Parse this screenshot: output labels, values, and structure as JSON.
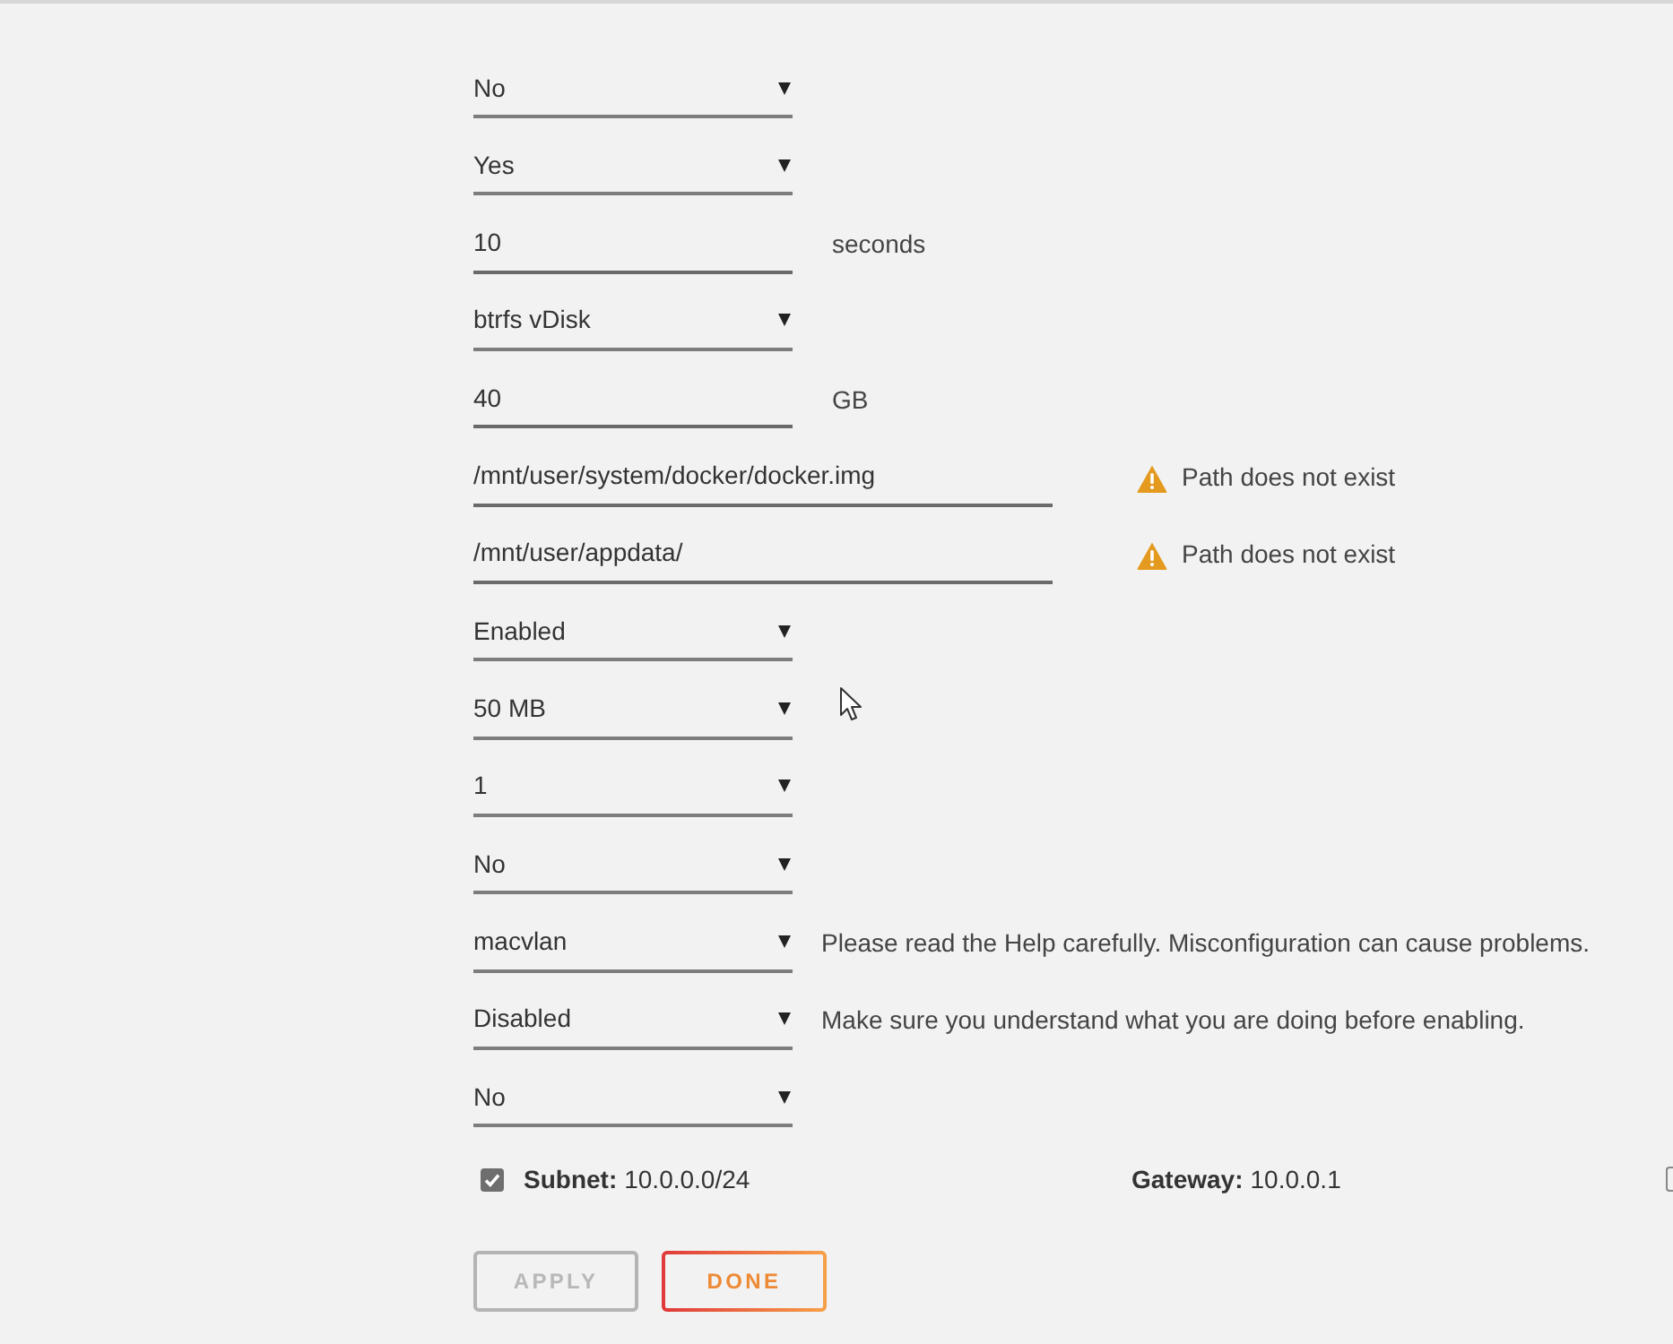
{
  "fields": [
    {
      "kind": "select",
      "value": "No"
    },
    {
      "kind": "select",
      "value": "Yes"
    },
    {
      "kind": "number",
      "value": "10",
      "unit": "seconds"
    },
    {
      "kind": "select",
      "value": "btrfs vDisk"
    },
    {
      "kind": "number",
      "value": "40",
      "unit": "GB"
    },
    {
      "kind": "path",
      "value": "/mnt/user/system/docker/docker.img",
      "warning": "Path does not exist"
    },
    {
      "kind": "path",
      "value": "/mnt/user/appdata/",
      "warning": "Path does not exist"
    },
    {
      "kind": "select",
      "value": "Enabled"
    },
    {
      "kind": "select",
      "value": "50 MB"
    },
    {
      "kind": "select",
      "value": "1"
    },
    {
      "kind": "select",
      "value": "No"
    },
    {
      "kind": "select",
      "value": "macvlan",
      "note": "Please read the Help carefully. Misconfiguration can cause problems."
    },
    {
      "kind": "select",
      "value": "Disabled",
      "note": "Make sure you understand what you are doing before enabling."
    },
    {
      "kind": "select",
      "value": "No"
    }
  ],
  "network": {
    "subnet": {
      "checked": true,
      "label": "Subnet:",
      "value": "10.0.0.0/24"
    },
    "gateway": {
      "label": "Gateway:",
      "value": "10.0.0.1"
    },
    "next_checkbox": {
      "checked": false
    }
  },
  "buttons": [
    {
      "label": "APPLY",
      "disabled": true
    },
    {
      "label": "DONE",
      "disabled": false
    }
  ]
}
